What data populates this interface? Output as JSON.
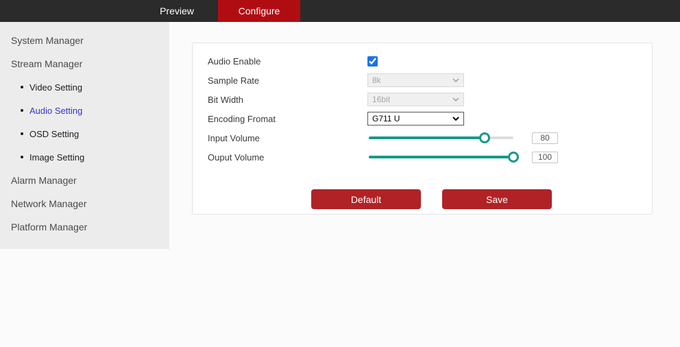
{
  "topbar": {
    "tabs": [
      {
        "label": "Preview",
        "active": false
      },
      {
        "label": "Configure",
        "active": true
      }
    ]
  },
  "sidebar": {
    "items": [
      {
        "label": "System Manager",
        "type": "group",
        "active": false
      },
      {
        "label": "Stream Manager",
        "type": "group",
        "active": false
      },
      {
        "label": "Video Setting",
        "type": "sub",
        "active": false
      },
      {
        "label": "Audio Setting",
        "type": "sub",
        "active": true
      },
      {
        "label": "OSD Setting",
        "type": "sub",
        "active": false
      },
      {
        "label": "Image Setting",
        "type": "sub",
        "active": false
      },
      {
        "label": "Alarm Manager",
        "type": "group",
        "active": false
      },
      {
        "label": "Network Manager",
        "type": "group",
        "active": false
      },
      {
        "label": "Platform Manager",
        "type": "group",
        "active": false
      }
    ]
  },
  "form": {
    "audio_enable": {
      "label": "Audio Enable",
      "checked": true
    },
    "sample_rate": {
      "label": "Sample Rate",
      "value": "8k",
      "disabled": true
    },
    "bit_width": {
      "label": "Bit Width",
      "value": "16bit",
      "disabled": true
    },
    "encoding_format": {
      "label": "Encoding Fromat",
      "value": "G711 U",
      "disabled": false
    },
    "input_volume": {
      "label": "Input Volume",
      "value": 80,
      "min": 0,
      "max": 100
    },
    "output_volume": {
      "label": "Ouput Volume",
      "value": 100,
      "min": 0,
      "max": 100
    }
  },
  "buttons": {
    "default_label": "Default",
    "save_label": "Save"
  },
  "colors": {
    "topbar_bg": "#2b2b2b",
    "tab_active_red": "#b00d12",
    "button_red": "#b02225",
    "slider_teal": "#17998a",
    "checkbox_blue": "#1a73e8",
    "active_link_blue": "#3333cc",
    "sidebar_bg": "#ececec"
  }
}
